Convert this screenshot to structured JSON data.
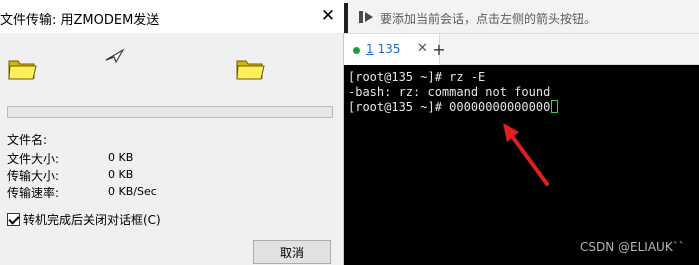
{
  "dialog": {
    "title": "文件传输: 用ZMODEM发送",
    "close_glyph": "✕",
    "transfer_progress": 0,
    "fields": [
      {
        "label": "文件名:",
        "value": ""
      },
      {
        "label": "文件大小:",
        "value": "0 KB"
      },
      {
        "label": "传输大小:",
        "value": "0 KB"
      },
      {
        "label": "传输速率:",
        "value": "0 KB/Sec"
      }
    ],
    "close_after_transfer_label": "转机完成后关闭对话框(C)",
    "close_after_transfer_checked": true,
    "cancel_label": "取消",
    "icons": {
      "source_folder": "folder-icon",
      "transfer": "paper-plane-icon",
      "dest_folder": "folder-icon"
    }
  },
  "session_hint": {
    "text": "要添加当前会话，点击左侧的箭头按钮。",
    "icon": "session-arrow-icon"
  },
  "tabs": [
    {
      "underlined": "1",
      "label": " 135",
      "status_color": "#1f9c3c",
      "close_glyph": "✕"
    }
  ],
  "new_tab_glyph": "+",
  "terminal": {
    "lines": [
      "[root@135 ~]# rz -E",
      "-bash: rz: command not found",
      "[root@135 ~]# 00000000000000"
    ],
    "cursor_color": "#2fd84b"
  },
  "annotation_arrow_color": "#e02020",
  "watermark": "CSDN @ELIAUK``"
}
